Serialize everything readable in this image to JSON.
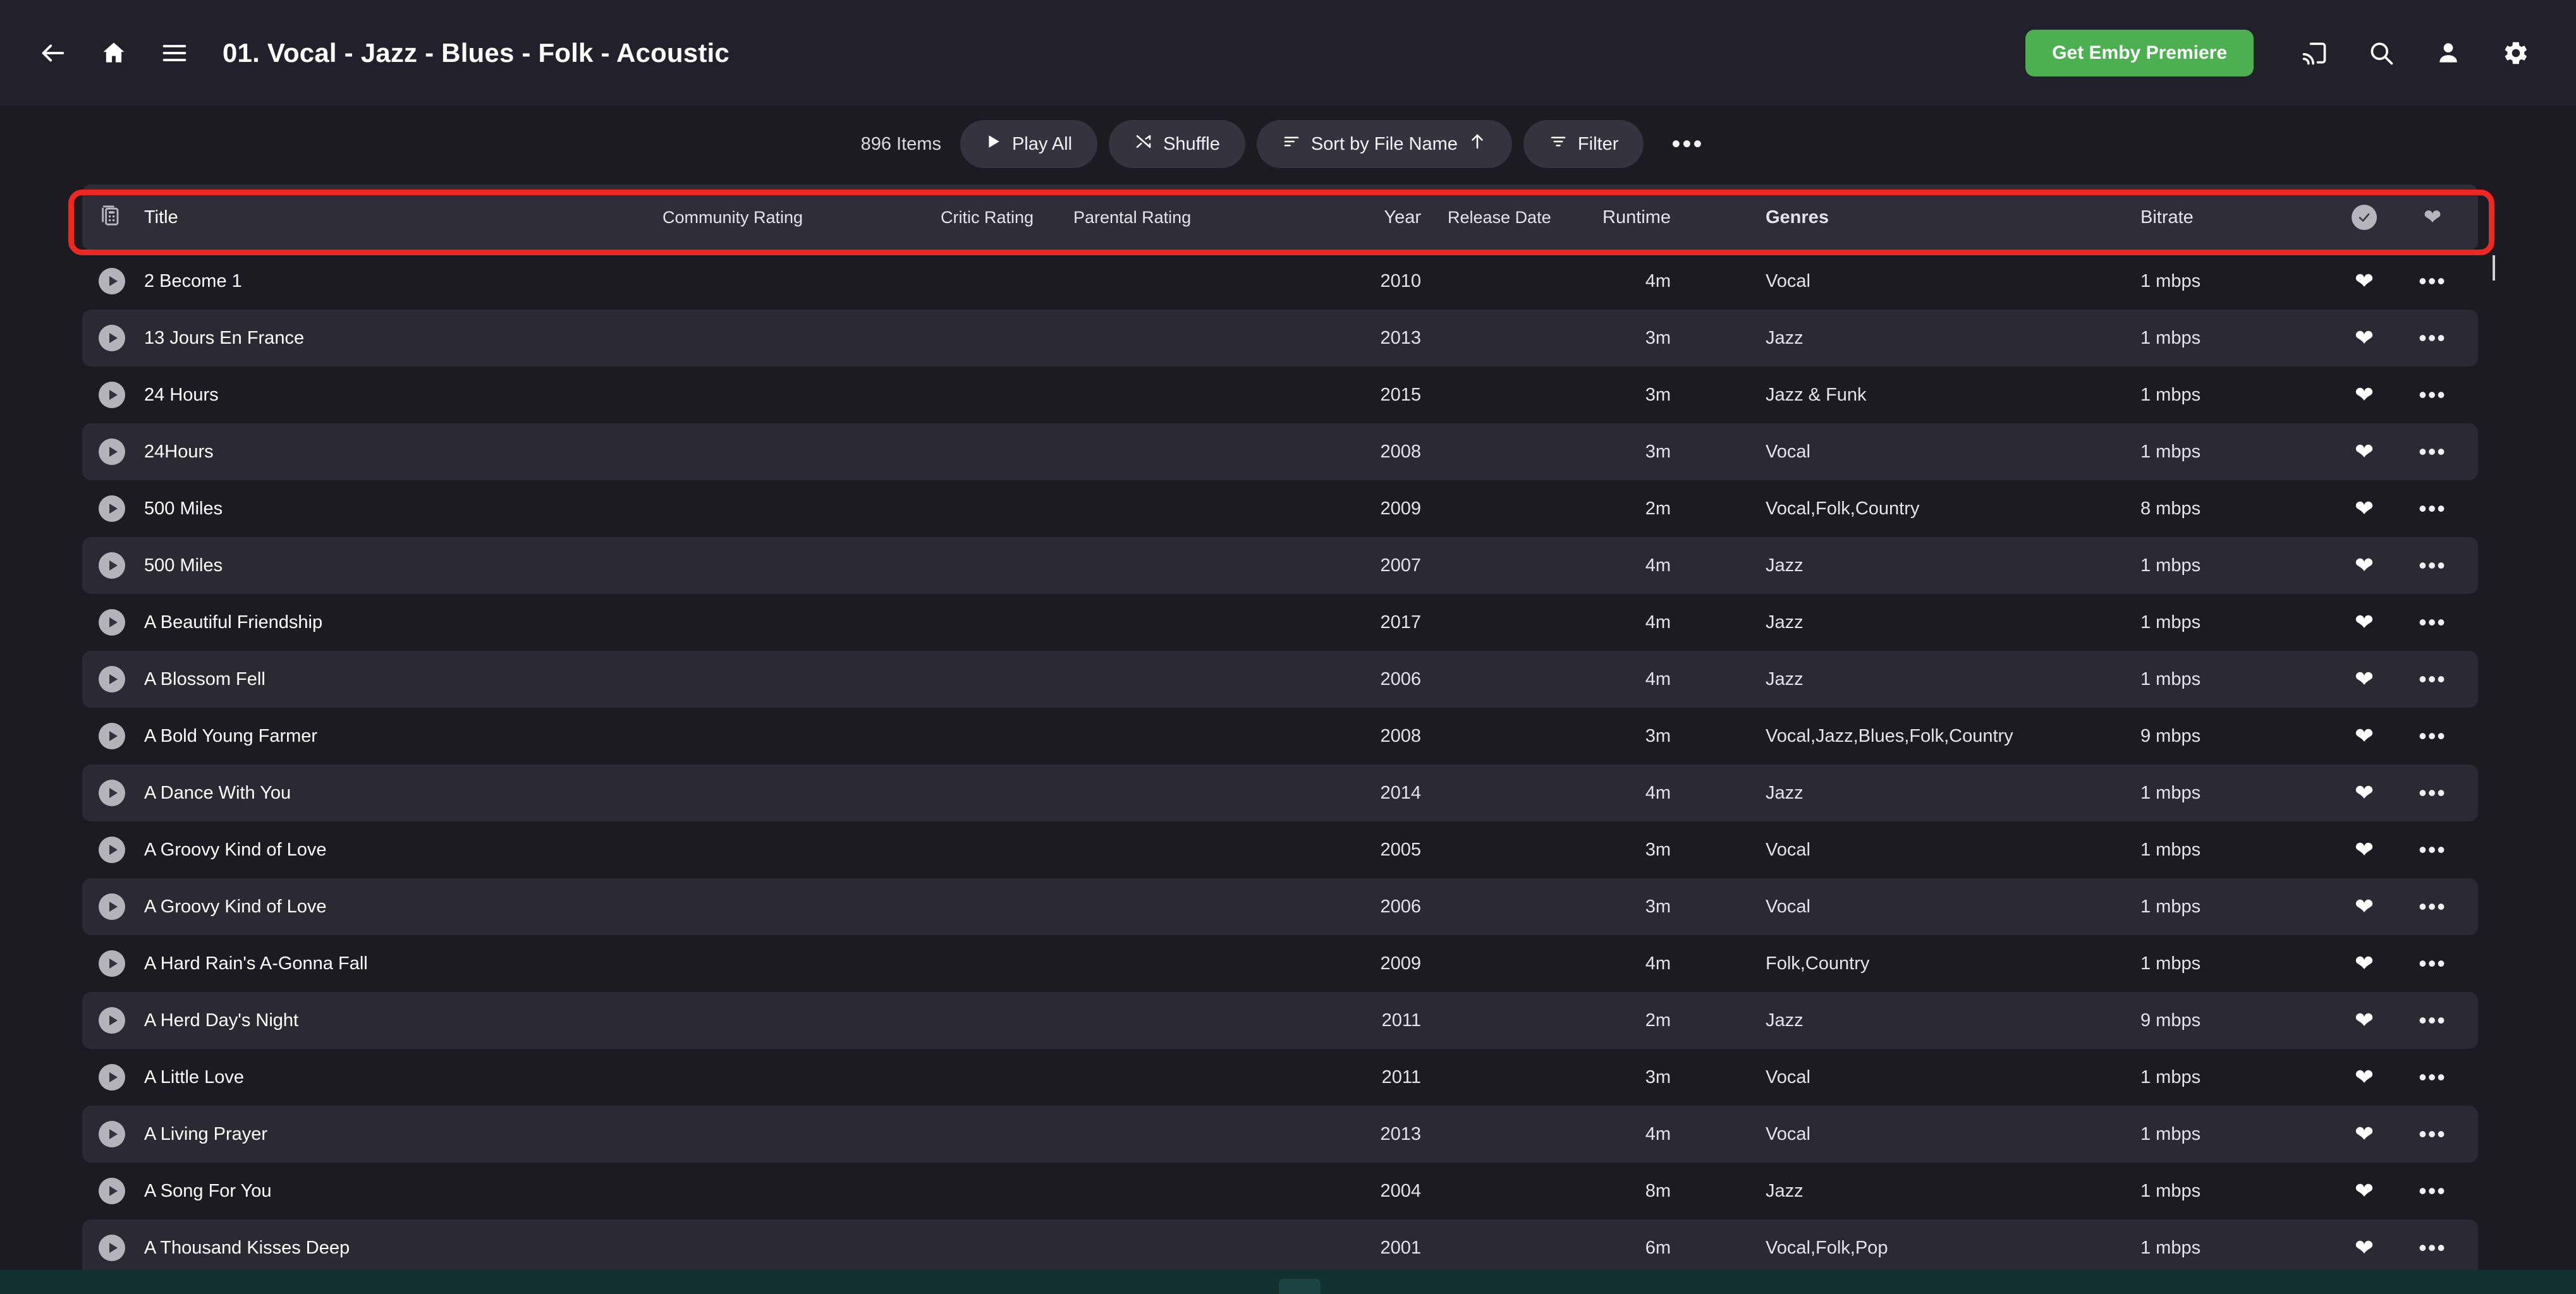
{
  "header": {
    "back_icon": "arrow-left-icon",
    "home_icon": "home-icon",
    "menu_icon": "hamburger-menu-icon",
    "title": "01. Vocal - Jazz - Blues - Folk - Acoustic",
    "premiere_label": "Get Emby Premiere",
    "premiere_color": "#4caf50",
    "cast_icon": "cast-icon",
    "search_icon": "search-icon",
    "user_icon": "user-icon",
    "settings_icon": "gear-icon"
  },
  "toolbar": {
    "item_count": "896 Items",
    "play_all_label": "Play All",
    "shuffle_label": "Shuffle",
    "sort_label": "Sort by File Name",
    "sort_direction": "ascending",
    "filter_label": "Filter",
    "more_label": "•••"
  },
  "table": {
    "highlight_color": "#ef2722",
    "columns": {
      "view_icon": "view-mode-icon",
      "title": "Title",
      "community_rating": "Community Rating",
      "critic_rating": "Critic Rating",
      "parental_rating": "Parental Rating",
      "year": "Year",
      "release_date": "Release Date",
      "runtime": "Runtime",
      "genres": "Genres",
      "bitrate": "Bitrate",
      "played_icon": "check-circle-icon",
      "favorite_icon": "heart-icon"
    },
    "rows": [
      {
        "title": "2 Become 1",
        "community_rating": "",
        "critic_rating": "",
        "parental_rating": "",
        "year": "2010",
        "release_date": "",
        "runtime": "4m",
        "genres": "Vocal",
        "bitrate": "1 mbps"
      },
      {
        "title": "13 Jours En France",
        "community_rating": "",
        "critic_rating": "",
        "parental_rating": "",
        "year": "2013",
        "release_date": "",
        "runtime": "3m",
        "genres": "Jazz",
        "bitrate": "1 mbps"
      },
      {
        "title": "24 Hours",
        "community_rating": "",
        "critic_rating": "",
        "parental_rating": "",
        "year": "2015",
        "release_date": "",
        "runtime": "3m",
        "genres": "Jazz & Funk",
        "bitrate": "1 mbps"
      },
      {
        "title": "24Hours",
        "community_rating": "",
        "critic_rating": "",
        "parental_rating": "",
        "year": "2008",
        "release_date": "",
        "runtime": "3m",
        "genres": "Vocal",
        "bitrate": "1 mbps"
      },
      {
        "title": "500 Miles",
        "community_rating": "",
        "critic_rating": "",
        "parental_rating": "",
        "year": "2009",
        "release_date": "",
        "runtime": "2m",
        "genres": "Vocal,Folk,Country",
        "bitrate": "8 mbps"
      },
      {
        "title": "500 Miles",
        "community_rating": "",
        "critic_rating": "",
        "parental_rating": "",
        "year": "2007",
        "release_date": "",
        "runtime": "4m",
        "genres": "Jazz",
        "bitrate": "1 mbps"
      },
      {
        "title": "A Beautiful Friendship",
        "community_rating": "",
        "critic_rating": "",
        "parental_rating": "",
        "year": "2017",
        "release_date": "",
        "runtime": "4m",
        "genres": "Jazz",
        "bitrate": "1 mbps"
      },
      {
        "title": "A Blossom Fell",
        "community_rating": "",
        "critic_rating": "",
        "parental_rating": "",
        "year": "2006",
        "release_date": "",
        "runtime": "4m",
        "genres": "Jazz",
        "bitrate": "1 mbps"
      },
      {
        "title": "A Bold Young Farmer",
        "community_rating": "",
        "critic_rating": "",
        "parental_rating": "",
        "year": "2008",
        "release_date": "",
        "runtime": "3m",
        "genres": "Vocal,Jazz,Blues,Folk,Country",
        "bitrate": "9 mbps"
      },
      {
        "title": "A Dance With You",
        "community_rating": "",
        "critic_rating": "",
        "parental_rating": "",
        "year": "2014",
        "release_date": "",
        "runtime": "4m",
        "genres": "Jazz",
        "bitrate": "1 mbps"
      },
      {
        "title": "A Groovy Kind of Love",
        "community_rating": "",
        "critic_rating": "",
        "parental_rating": "",
        "year": "2005",
        "release_date": "",
        "runtime": "3m",
        "genres": "Vocal",
        "bitrate": "1 mbps"
      },
      {
        "title": "A Groovy Kind of Love",
        "community_rating": "",
        "critic_rating": "",
        "parental_rating": "",
        "year": "2006",
        "release_date": "",
        "runtime": "3m",
        "genres": "Vocal",
        "bitrate": "1 mbps"
      },
      {
        "title": "A Hard Rain's A-Gonna Fall",
        "community_rating": "",
        "critic_rating": "",
        "parental_rating": "",
        "year": "2009",
        "release_date": "",
        "runtime": "4m",
        "genres": "Folk,Country",
        "bitrate": "1 mbps"
      },
      {
        "title": "A Herd Day's Night",
        "community_rating": "",
        "critic_rating": "",
        "parental_rating": "",
        "year": "2011",
        "release_date": "",
        "runtime": "2m",
        "genres": "Jazz",
        "bitrate": "9 mbps"
      },
      {
        "title": "A Little Love",
        "community_rating": "",
        "critic_rating": "",
        "parental_rating": "",
        "year": "2011",
        "release_date": "",
        "runtime": "3m",
        "genres": "Vocal",
        "bitrate": "1 mbps"
      },
      {
        "title": "A Living Prayer",
        "community_rating": "",
        "critic_rating": "",
        "parental_rating": "",
        "year": "2013",
        "release_date": "",
        "runtime": "4m",
        "genres": "Vocal",
        "bitrate": "1 mbps"
      },
      {
        "title": "A Song For You",
        "community_rating": "",
        "critic_rating": "",
        "parental_rating": "",
        "year": "2004",
        "release_date": "",
        "runtime": "8m",
        "genres": "Jazz",
        "bitrate": "1 mbps"
      },
      {
        "title": "A Thousand Kisses Deep",
        "community_rating": "",
        "critic_rating": "",
        "parental_rating": "",
        "year": "2001",
        "release_date": "",
        "runtime": "6m",
        "genres": "Vocal,Folk,Pop",
        "bitrate": "1 mbps"
      }
    ],
    "row_favorite_icon": "heart-icon",
    "row_menu_icon": "more-options-icon",
    "row_play_icon": "play-icon"
  }
}
